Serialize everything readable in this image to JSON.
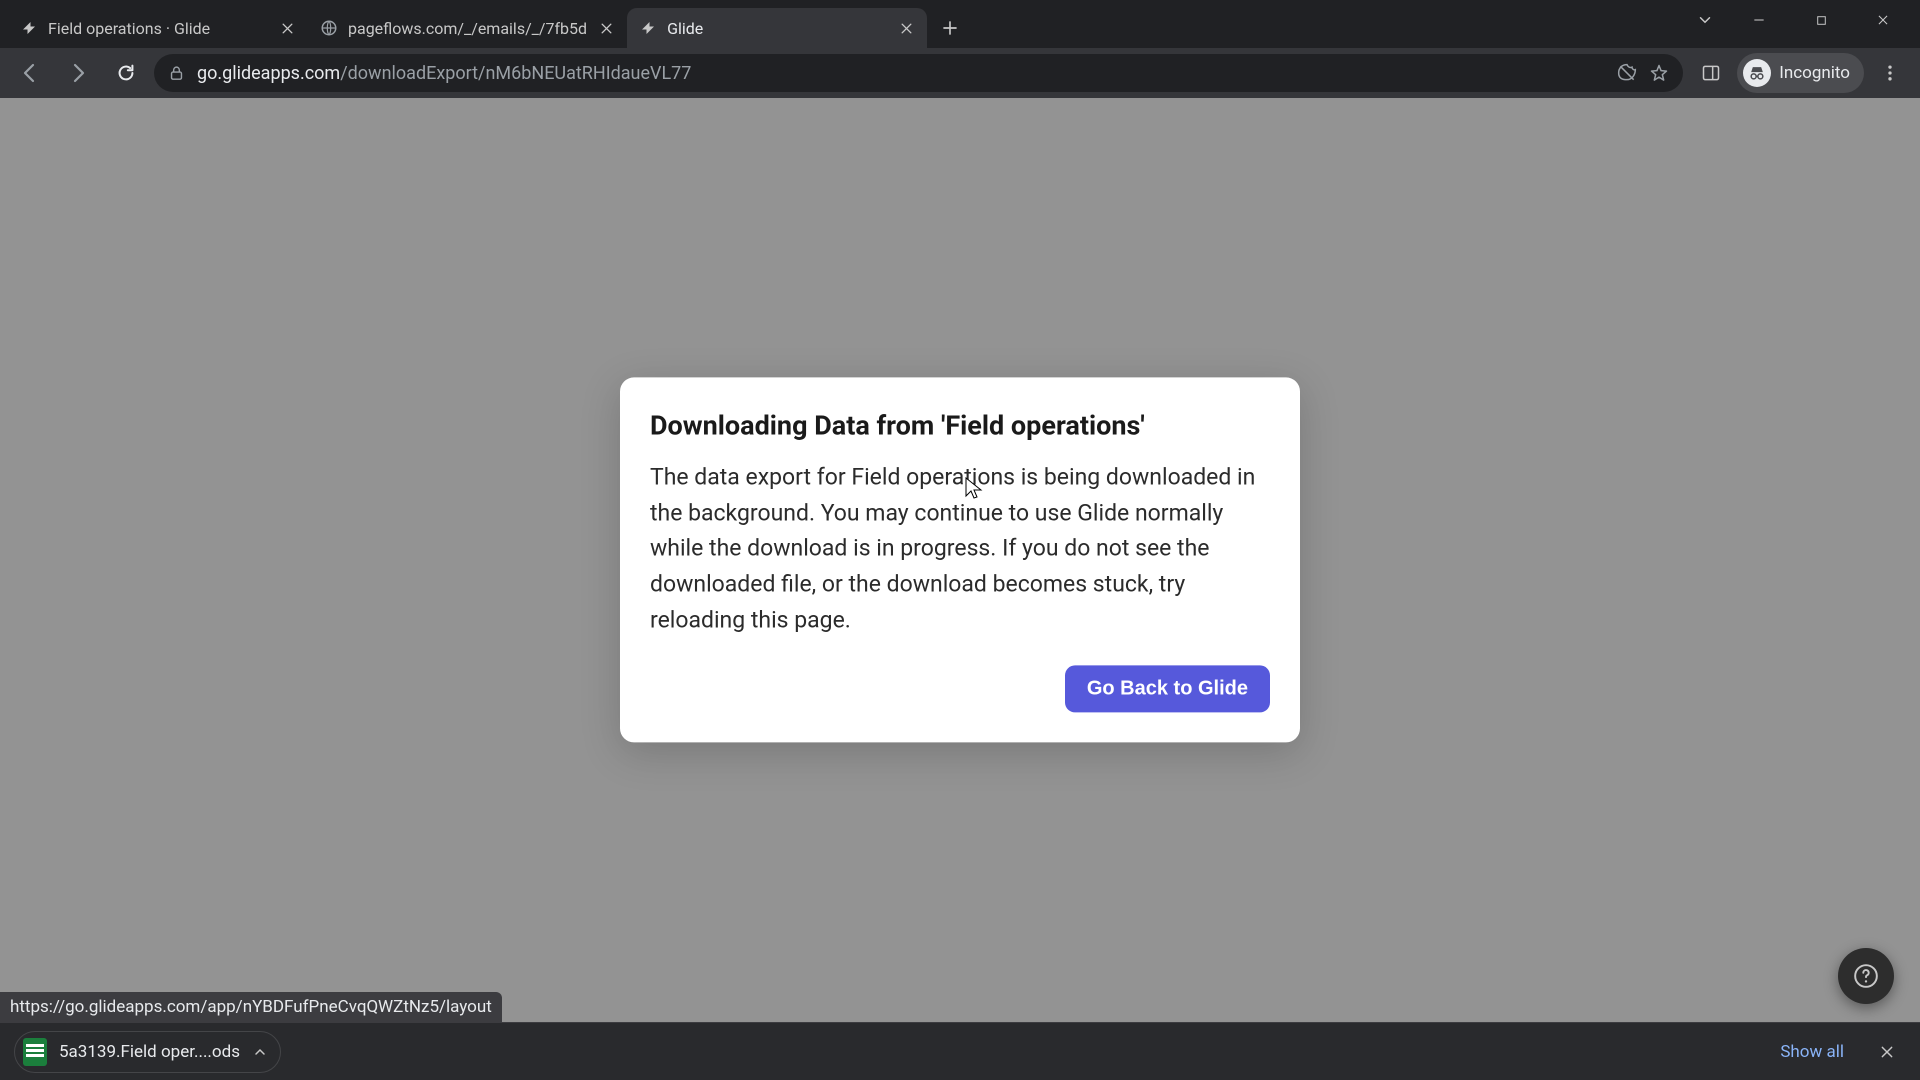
{
  "tabs": [
    {
      "label": "Field operations · Glide",
      "favicon": "glide"
    },
    {
      "label": "pageflows.com/_/emails/_/7fb5d",
      "favicon": "globe"
    },
    {
      "label": "Glide",
      "favicon": "glide",
      "active": true
    }
  ],
  "url": {
    "domain": "go.glideapps.com",
    "path": "/downloadExport/nM6bNEUatRHIdaueVL77"
  },
  "incognito_label": "Incognito",
  "modal": {
    "title": "Downloading Data from 'Field operations'",
    "body": "The data export for Field operations is being downloaded in the background. You may continue to use Glide normally while the download is in progress. If you do not see the downloaded file, or the download becomes stuck, try reloading this page.",
    "cta": "Go Back to Glide"
  },
  "status_url": "https://go.glideapps.com/app/nYBDFufPneCvqQWZtNz5/layout",
  "download": {
    "filename": "5a3139.Field oper....ods"
  },
  "shelf": {
    "show_all": "Show all"
  },
  "colors": {
    "accent": "#5659db"
  }
}
